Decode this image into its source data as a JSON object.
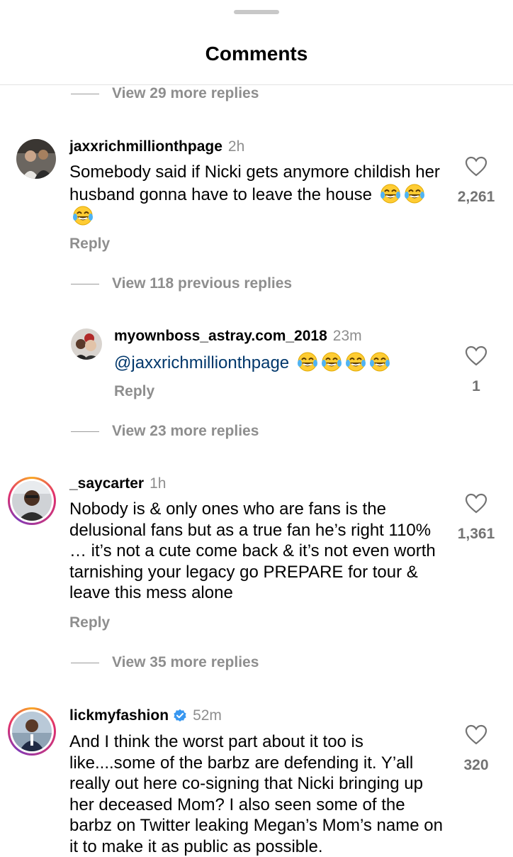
{
  "header": {
    "title": "Comments"
  },
  "threads": [
    {
      "view_more_top": "View 29 more replies",
      "comment": {
        "username": "jaxxrichmillionthpage",
        "time": "2h",
        "text": "Somebody said if Nicki gets anymore childish her husband gonna have to leave the house",
        "emojis": [
          "tears-of-joy",
          "tears-of-joy",
          "tears-of-joy"
        ],
        "likes": "2,261",
        "reply_label": "Reply"
      },
      "view_previous": "View 118 previous replies",
      "reply": {
        "username": "myownboss_astray.com_2018",
        "time": "23m",
        "mention": "@jaxxrichmillionthpage",
        "emojis": [
          "tears-of-joy",
          "tears-of-joy",
          "tears-of-joy",
          "tears-of-joy"
        ],
        "likes": "1",
        "reply_label": "Reply"
      },
      "view_more": "View 23 more replies"
    },
    {
      "comment": {
        "username": "_saycarter",
        "time": "1h",
        "text": "Nobody is & only ones who are fans is the delusional fans but as a true fan he’s right 110% … it’s not a cute come back & it’s not even worth tarnishing your legacy go PREPARE for tour & leave this mess alone",
        "likes": "1,361",
        "reply_label": "Reply"
      },
      "view_more": "View 35 more replies"
    },
    {
      "comment": {
        "username": "lickmyfashion",
        "verified": true,
        "time": "52m",
        "text": "And I think the worst part about it too is like....some of the barbz are defending it. Y’all really out here co-signing that Nicki bringing up her deceased Mom? I also seen some of the barbz on Twitter leaking Megan’s Mom’s name on it to make it as public as possible.",
        "likes": "320"
      }
    }
  ],
  "colors": {
    "link": "#00376b",
    "muted": "#8e8e8e",
    "verified": "#3897f0"
  }
}
